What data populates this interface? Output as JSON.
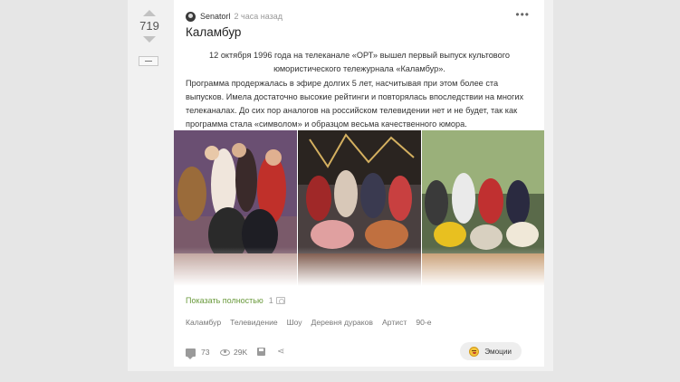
{
  "vote": {
    "count": "719"
  },
  "post": {
    "author": "Senatorl",
    "time": "2 часа назад",
    "title": "Каламбур",
    "paragraph1": "12 октября 1996 года на телеканале «ОРТ» вышел первый выпуск культового юмористического тележурнала «Каламбур».",
    "paragraph2": "Программа продержалась в эфире долгих 5 лет, насчитывая при этом более ста выпусков. Имела достаточно высокие рейтинги и повторялась впоследствии на многих телеканалах. До сих пор аналогов на российском телевидении нет и не будет, так как программа стала «символом» и образцом весьма качественного юмора.",
    "show_more": "Показать полностью",
    "image_count": "1",
    "tags": [
      "Каламбур",
      "Телевидение",
      "Шоу",
      "Деревня дураков",
      "Артист",
      "90-е"
    ]
  },
  "footer": {
    "comments": "73",
    "views": "29K",
    "emotions_label": "Эмоции"
  },
  "icons": {
    "comment": "comment-icon",
    "views": "eye-icon",
    "save": "save-icon",
    "share": "share-icon",
    "emotion": "emoji-icon",
    "camera": "camera-icon",
    "more": "more-dots-icon"
  },
  "colors": {
    "link_green": "#6a9a3c",
    "muted": "#999999",
    "card_bg": "#ffffff",
    "page_bg": "#e6e6e6"
  }
}
